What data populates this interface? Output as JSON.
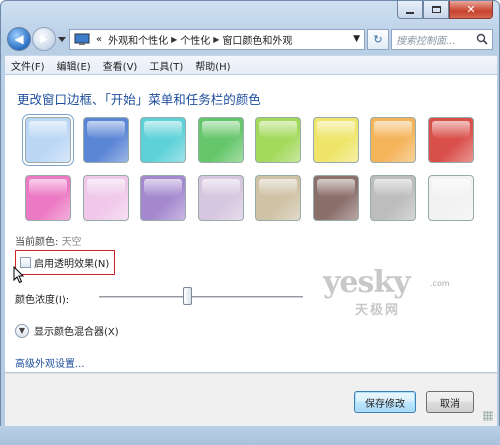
{
  "window": {
    "caption_buttons": [
      "minimize-icon",
      "maximize-icon",
      "close-icon"
    ]
  },
  "address_bar": {
    "segments": [
      "«",
      "外观和个性化",
      "个性化",
      "窗口颜色和外观"
    ],
    "search_placeholder": "搜索控制面..."
  },
  "menu": {
    "items": [
      "文件(F)",
      "编辑(E)",
      "查看(V)",
      "工具(T)",
      "帮助(H)"
    ]
  },
  "main": {
    "heading": "更改窗口边框、「开始」菜单和任务栏的颜色",
    "swatch_colors": [
      "#bcd7f5",
      "#5b86d6",
      "#5ed1d8",
      "#66c66b",
      "#a3d95b",
      "#efe56a",
      "#f4b45a",
      "#d9504b",
      "#ec79c3",
      "#f0c9ea",
      "#a589cf",
      "#d7c6df",
      "#cfc2a5",
      "#8b6f6b",
      "#bdbdbd",
      "#f2f2f2"
    ],
    "selected_swatch": 0,
    "current_color_label": "当前颜色:",
    "current_color_value": "天空",
    "transparency_label": "启用透明效果(N)",
    "transparency_checked": false,
    "intensity_label": "颜色浓度(I):",
    "intensity_value": 0.43,
    "mixer_label": "显示颜色混合器(X)",
    "advanced_link": "高级外观设置..."
  },
  "watermark": {
    "brand": "yesky",
    "suffix": ".com",
    "cn": "天极网"
  },
  "footer": {
    "save_label": "保存修改",
    "cancel_label": "取消"
  }
}
